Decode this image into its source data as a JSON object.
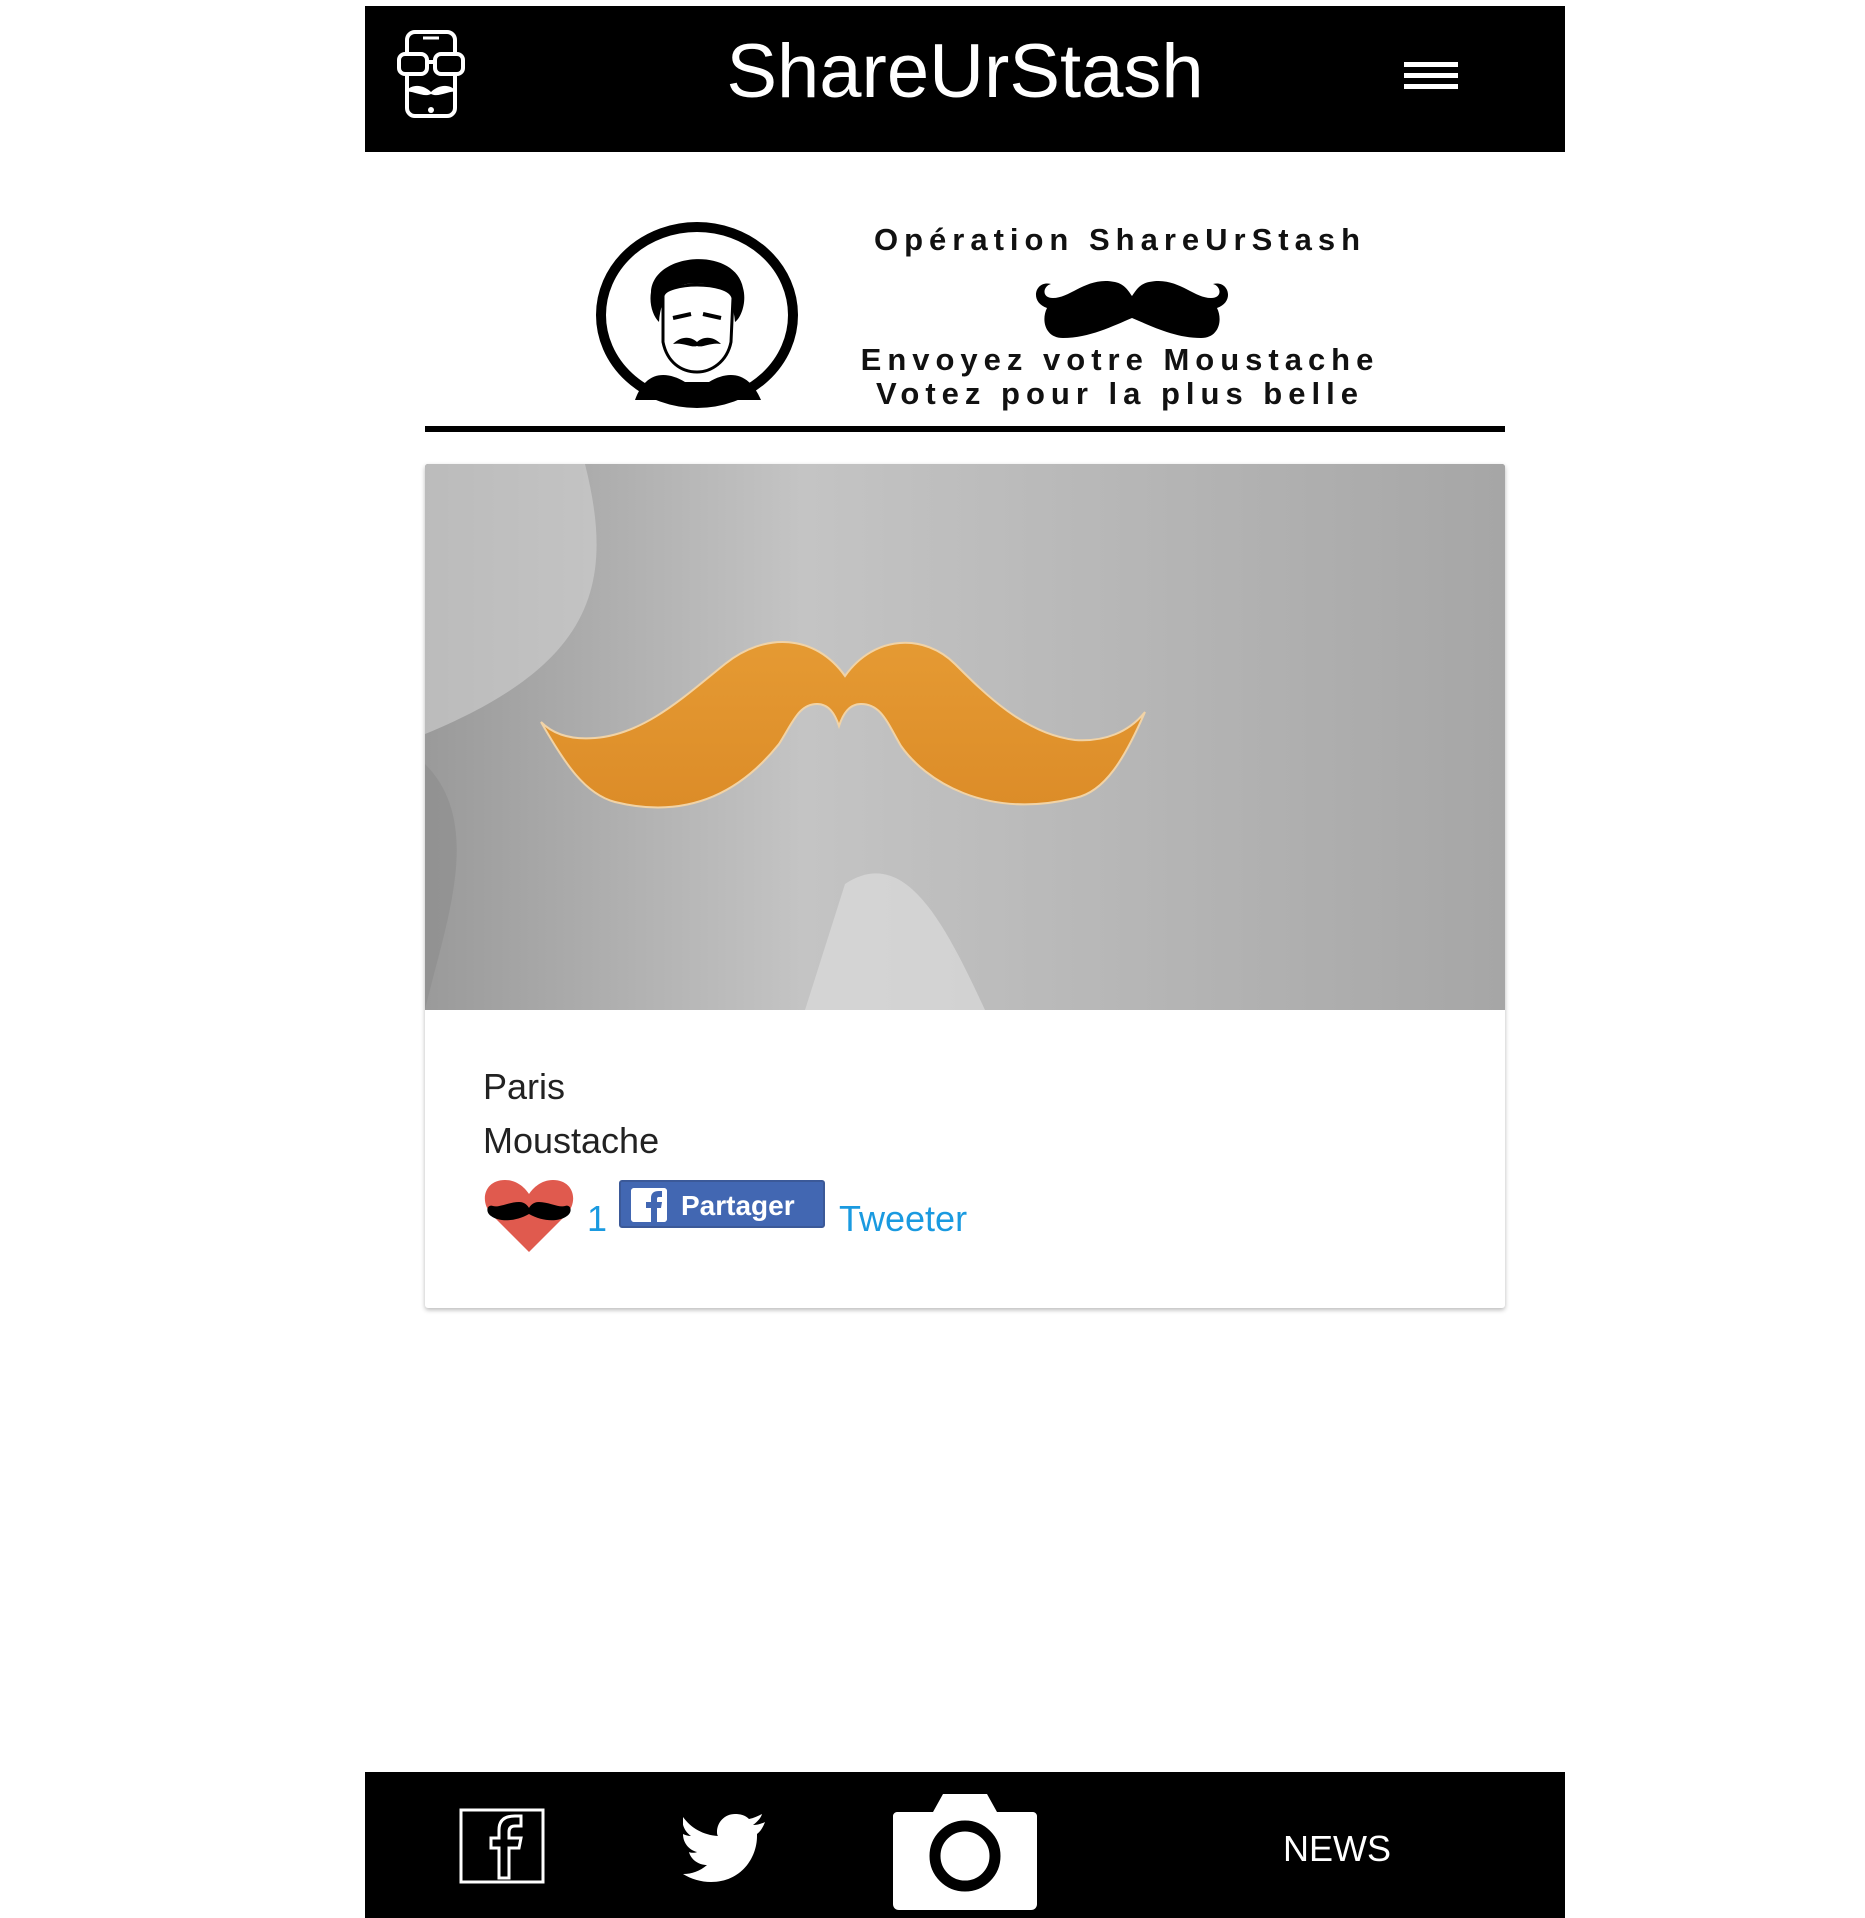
{
  "header": {
    "title": "ShareUrStash"
  },
  "banner": {
    "line1": "Opération ShareUrStash",
    "line2": "Envoyez votre Moustache",
    "line3": "Votez pour la plus belle"
  },
  "post": {
    "city": "Paris",
    "caption": "Moustache",
    "likes": "1",
    "share_label": "Partager",
    "tweet_label": "Tweeter"
  },
  "bottom_nav": {
    "news_label": "NEWS"
  },
  "colors": {
    "bar": "#000000",
    "link": "#1a9ae0",
    "facebook": "#4267b2",
    "heart": "#e05a4e",
    "mustache_photo": "#e0922f"
  },
  "icons": [
    "app-logo-icon",
    "menu-icon",
    "heart-mustache-icon",
    "facebook-icon",
    "twitter-icon",
    "camera-icon"
  ]
}
